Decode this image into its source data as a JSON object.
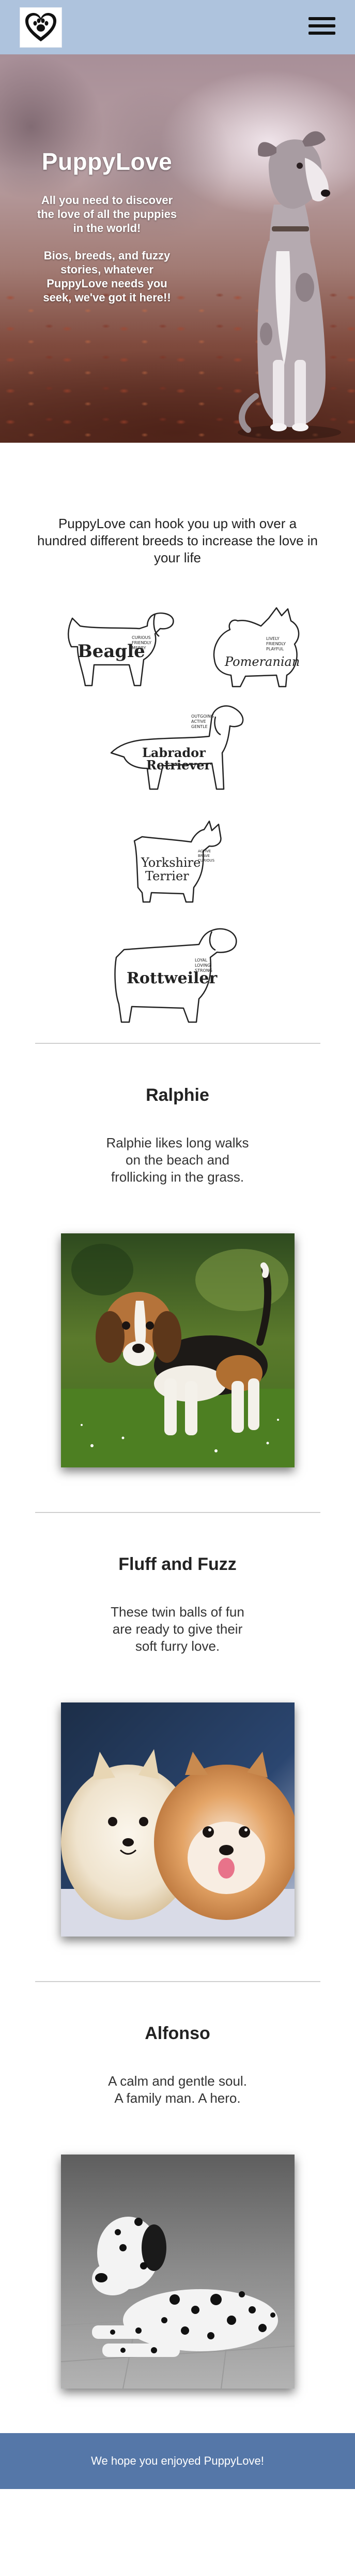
{
  "colors": {
    "navbar_bg": "#aec3dd",
    "footer_bg": "#5577a8",
    "divider": "#cfcfcf"
  },
  "header": {
    "logo_icon": "heart-paw-icon",
    "menu_icon": "hamburger-menu-icon"
  },
  "hero": {
    "title": "PuppyLove",
    "paragraph_1": "All you need to discover the love of all the puppies in the world!",
    "paragraph_2": "Bios, breeds, and fuzzy stories, whatever PuppyLove needs you seek, we've got it here!!"
  },
  "intro": {
    "text": "PuppyLove can hook you up with over a hundred different breeds to increase the love in your life"
  },
  "breeds": [
    {
      "name": "Beagle",
      "traits": [
        "CURIOUS",
        "FRIENDLY",
        "MERRY"
      ]
    },
    {
      "name": "Pomeranian",
      "traits": [
        "LIVELY",
        "FRIENDLY",
        "PLAYFUL"
      ]
    },
    {
      "name": "Labrador Retriever",
      "name_line_1": "Labrador",
      "name_line_2": "Retriever",
      "traits": [
        "OUTGOING",
        "ACTIVE",
        "GENTLE"
      ]
    },
    {
      "name": "Yorkshire Terrier",
      "name_line_1": "Yorkshire",
      "name_line_2": "Terrier",
      "traits": [
        "ACTIVE",
        "BRAVE",
        "CURIOUS"
      ]
    },
    {
      "name": "Rottweiler",
      "traits": [
        "LOYAL",
        "LOVING",
        "STRONG"
      ]
    }
  ],
  "dogs": [
    {
      "name": "Ralphie",
      "description": "Ralphie likes long walks on the beach and frollicking in the grass."
    },
    {
      "name": "Fluff and Fuzz",
      "description": "These twin balls of fun are ready to give their soft furry love."
    },
    {
      "name": "Alfonso",
      "description": "A calm and gentle soul. A family man. A hero."
    }
  ],
  "footer": {
    "text": "We hope you enjoyed PuppyLove!"
  }
}
